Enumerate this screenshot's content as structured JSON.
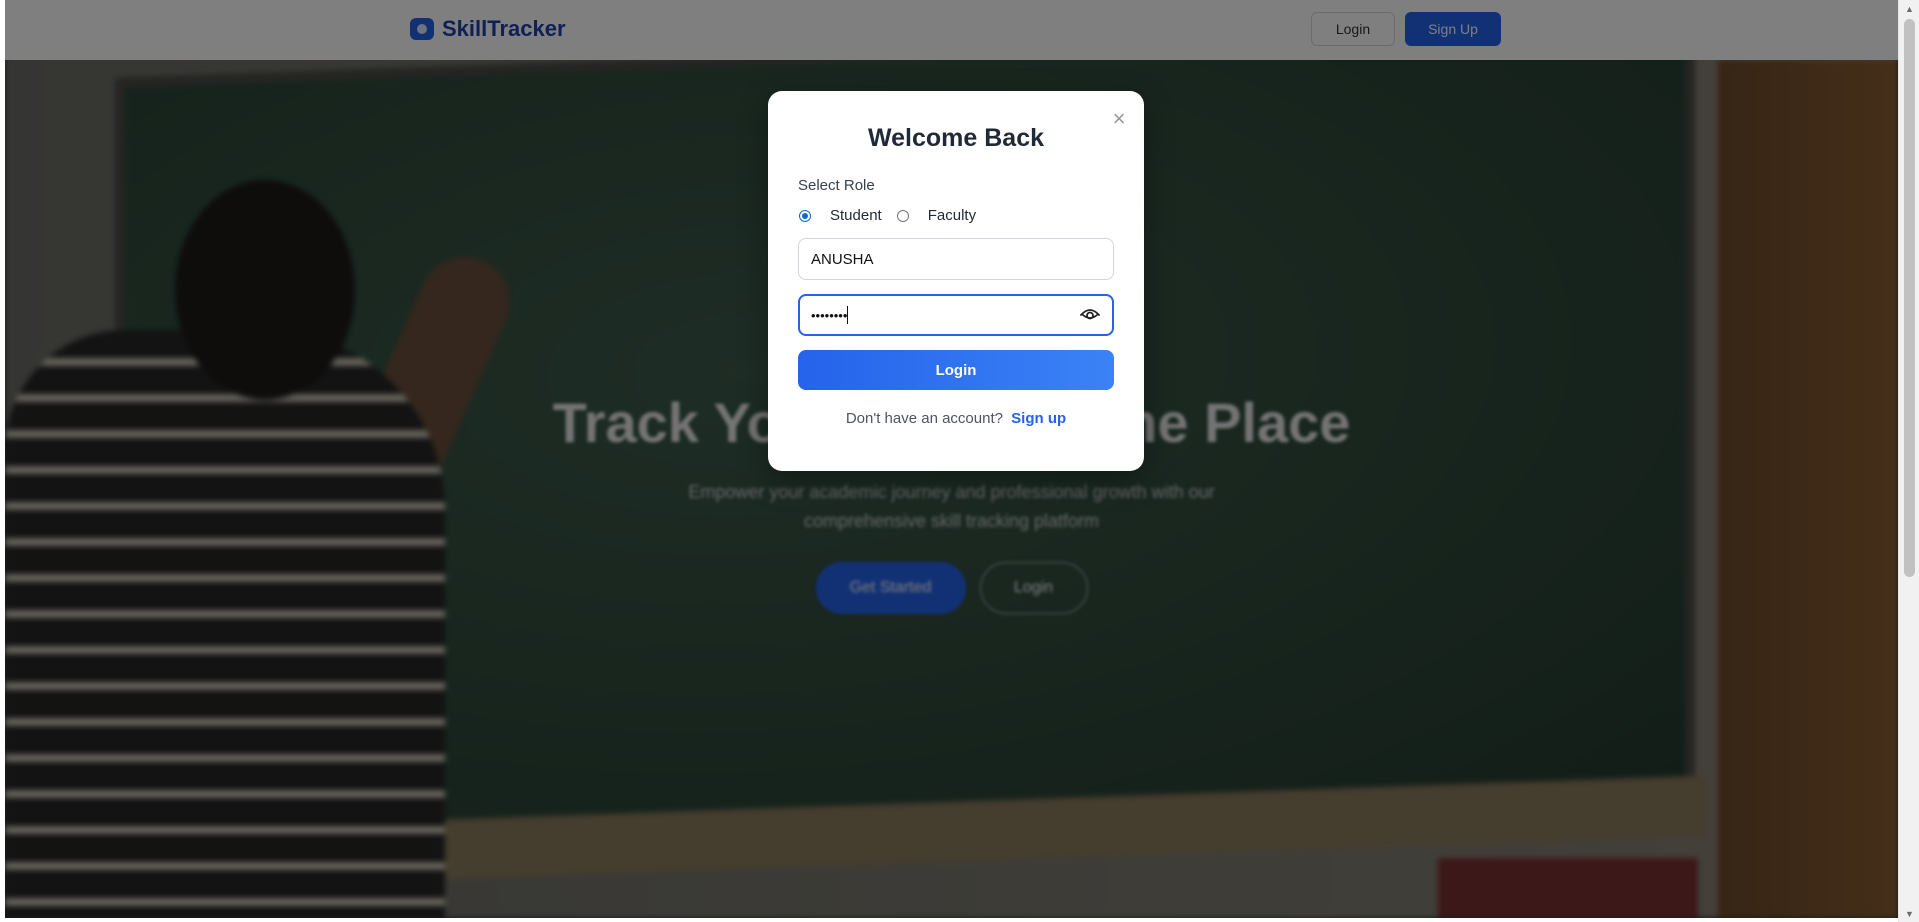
{
  "navbar": {
    "brand": "SkillTracker",
    "login_label": "Login",
    "signup_label": "Sign Up"
  },
  "hero": {
    "title": "Track Your Skills in One Place",
    "subtitle": "Empower your academic journey and professional growth with our comprehensive skill tracking platform",
    "primary_cta": "Get Started",
    "secondary_cta": "Login"
  },
  "modal": {
    "title": "Welcome Back",
    "close_glyph": "×",
    "role_label": "Select Role",
    "roles": [
      {
        "label": "Student",
        "selected": true
      },
      {
        "label": "Faculty",
        "selected": false
      }
    ],
    "username_value": "ANUSHA",
    "password_value": "••••••••",
    "login_button": "Login",
    "signup_prompt": "Don't have an account?",
    "signup_link": "Sign up"
  },
  "colors": {
    "accent": "#2563eb",
    "title": "#1f2937"
  },
  "icons": {
    "brand": "logo-icon",
    "password_toggle": "eye-icon",
    "close": "close-icon"
  }
}
